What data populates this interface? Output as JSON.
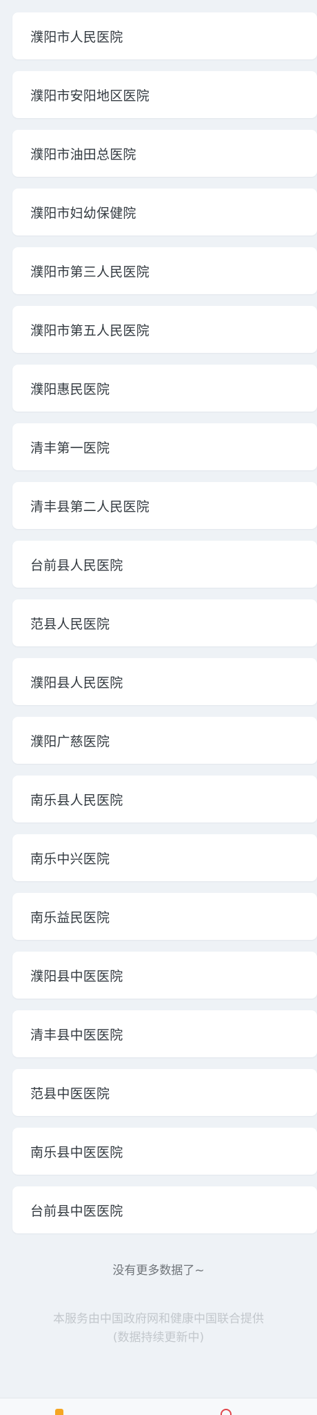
{
  "hospitals": [
    "濮阳市人民医院",
    "濮阳市安阳地区医院",
    "濮阳市油田总医院",
    "濮阳市妇幼保健院",
    "濮阳市第三人民医院",
    "濮阳市第五人民医院",
    "濮阳惠民医院",
    "清丰第一医院",
    "清丰县第二人民医院",
    "台前县人民医院",
    "范县人民医院",
    "濮阳县人民医院",
    "濮阳广慈医院",
    "南乐县人民医院",
    "南乐中兴医院",
    "南乐益民医院",
    "濮阳县中医医院",
    "清丰县中医医院",
    "范县中医医院",
    "南乐县中医医院",
    "台前县中医医院"
  ],
  "status": {
    "no_more": "没有更多数据了~"
  },
  "footer": {
    "line1": "本服务由中国政府网和健康中国联合提供",
    "line2": "(数据持续更新中)"
  },
  "tabbar": {
    "icons": [
      "home-icon",
      "user-icon"
    ]
  },
  "colors": {
    "background": "#eef2f6",
    "card": "#ffffff",
    "text": "#333a40",
    "footer_text": "#c2c7cc"
  }
}
